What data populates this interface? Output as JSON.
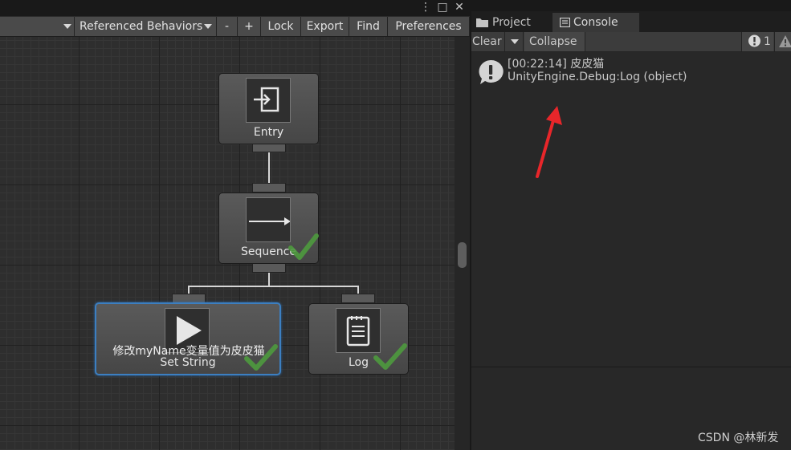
{
  "left_panel": {
    "window_controls": {
      "menu": "⋮",
      "maximize": "□",
      "close": "✕"
    },
    "toolbar": {
      "referenced_behaviors": "Referenced Behaviors",
      "minus": "-",
      "plus": "+",
      "lock": "Lock",
      "export": "Export",
      "find": "Find",
      "preferences": "Preferences"
    },
    "nodes": {
      "entry": {
        "label": "Entry",
        "icon": "entry-icon"
      },
      "sequence": {
        "label": "Sequence",
        "icon": "arrow-right-icon",
        "status": "success"
      },
      "set_string": {
        "label": "Set String",
        "icon": "play-icon",
        "status": "success",
        "selected": true,
        "comment": "修改myName变量值为皮皮猫"
      },
      "log": {
        "label": "Log",
        "icon": "notepad-icon",
        "status": "success"
      }
    }
  },
  "console_panel": {
    "tabs": [
      {
        "label": "Project",
        "icon": "folder-icon",
        "active": false
      },
      {
        "label": "Console",
        "icon": "console-icon",
        "active": true
      }
    ],
    "toolbar": {
      "clear": "Clear",
      "collapse": "Collapse",
      "info_count": "1"
    },
    "entries": [
      {
        "line1": "[00:22:14] 皮皮猫",
        "line2": "UnityEngine.Debug:Log (object)",
        "icon": "info-bubble-icon"
      }
    ]
  },
  "watermark": "CSDN @林新发",
  "colors": {
    "accent_selected": "#3c7fc1",
    "check_green": "#4e9a3e",
    "annotation_red": "#e8262a"
  }
}
